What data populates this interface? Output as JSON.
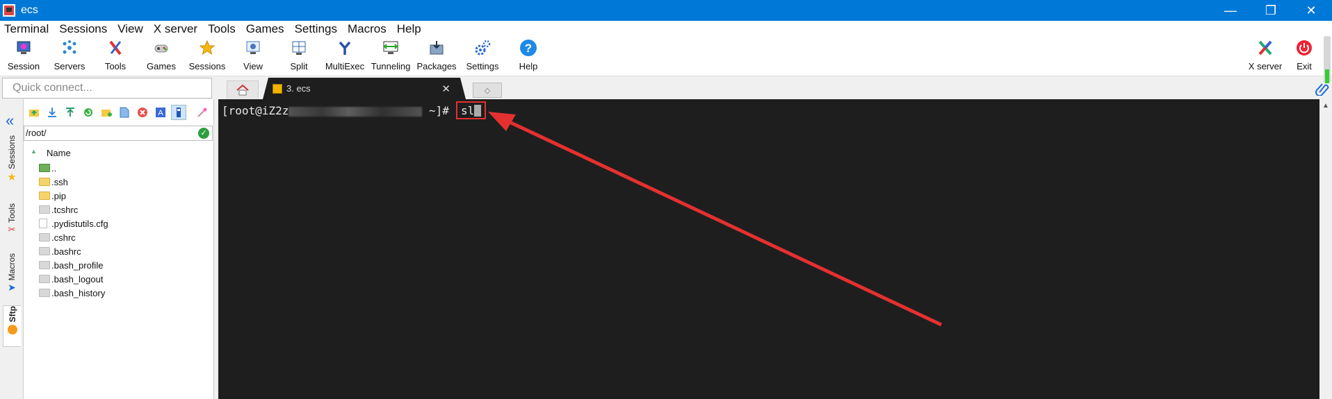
{
  "window": {
    "title": "ecs"
  },
  "menu": [
    "Terminal",
    "Sessions",
    "View",
    "X server",
    "Tools",
    "Games",
    "Settings",
    "Macros",
    "Help"
  ],
  "toolbar": {
    "items": [
      {
        "label": "Session",
        "icon": "session-icon"
      },
      {
        "label": "Servers",
        "icon": "servers-icon"
      },
      {
        "label": "Tools",
        "icon": "tools-icon"
      },
      {
        "label": "Games",
        "icon": "games-icon"
      },
      {
        "label": "Sessions",
        "icon": "star-icon"
      },
      {
        "label": "View",
        "icon": "view-icon"
      },
      {
        "label": "Split",
        "icon": "split-icon"
      },
      {
        "label": "MultiExec",
        "icon": "multiexec-icon"
      },
      {
        "label": "Tunneling",
        "icon": "tunneling-icon"
      },
      {
        "label": "Packages",
        "icon": "packages-icon"
      },
      {
        "label": "Settings",
        "icon": "settings-icon"
      },
      {
        "label": "Help",
        "icon": "help-icon"
      }
    ],
    "xserver_label": "X server",
    "exit_label": "Exit"
  },
  "quick_connect": {
    "placeholder": "Quick connect..."
  },
  "tabs": {
    "active": {
      "label": "3. ecs",
      "close": "✕"
    },
    "new_tab_glyph": "◇"
  },
  "side_tabs": [
    "Sessions",
    "Tools",
    "Macros",
    "Sftp"
  ],
  "sftp": {
    "path": "/root/",
    "column": "Name",
    "files": [
      {
        "name": "..",
        "type": "up"
      },
      {
        "name": ".ssh",
        "type": "folder"
      },
      {
        "name": ".pip",
        "type": "folder"
      },
      {
        "name": ".tcshrc",
        "type": "file"
      },
      {
        "name": ".pydistutils.cfg",
        "type": "doc"
      },
      {
        "name": ".cshrc",
        "type": "file"
      },
      {
        "name": ".bashrc",
        "type": "file"
      },
      {
        "name": ".bash_profile",
        "type": "file"
      },
      {
        "name": ".bash_logout",
        "type": "file"
      },
      {
        "name": ".bash_history",
        "type": "file"
      }
    ]
  },
  "terminal": {
    "prompt_start": "[root@iZ2z",
    "prompt_end": "~]#",
    "command": "sl"
  },
  "colors": {
    "titlebar": "#0078d7",
    "terminal_bg": "#1e1e1e",
    "annotation": "#e53030"
  }
}
